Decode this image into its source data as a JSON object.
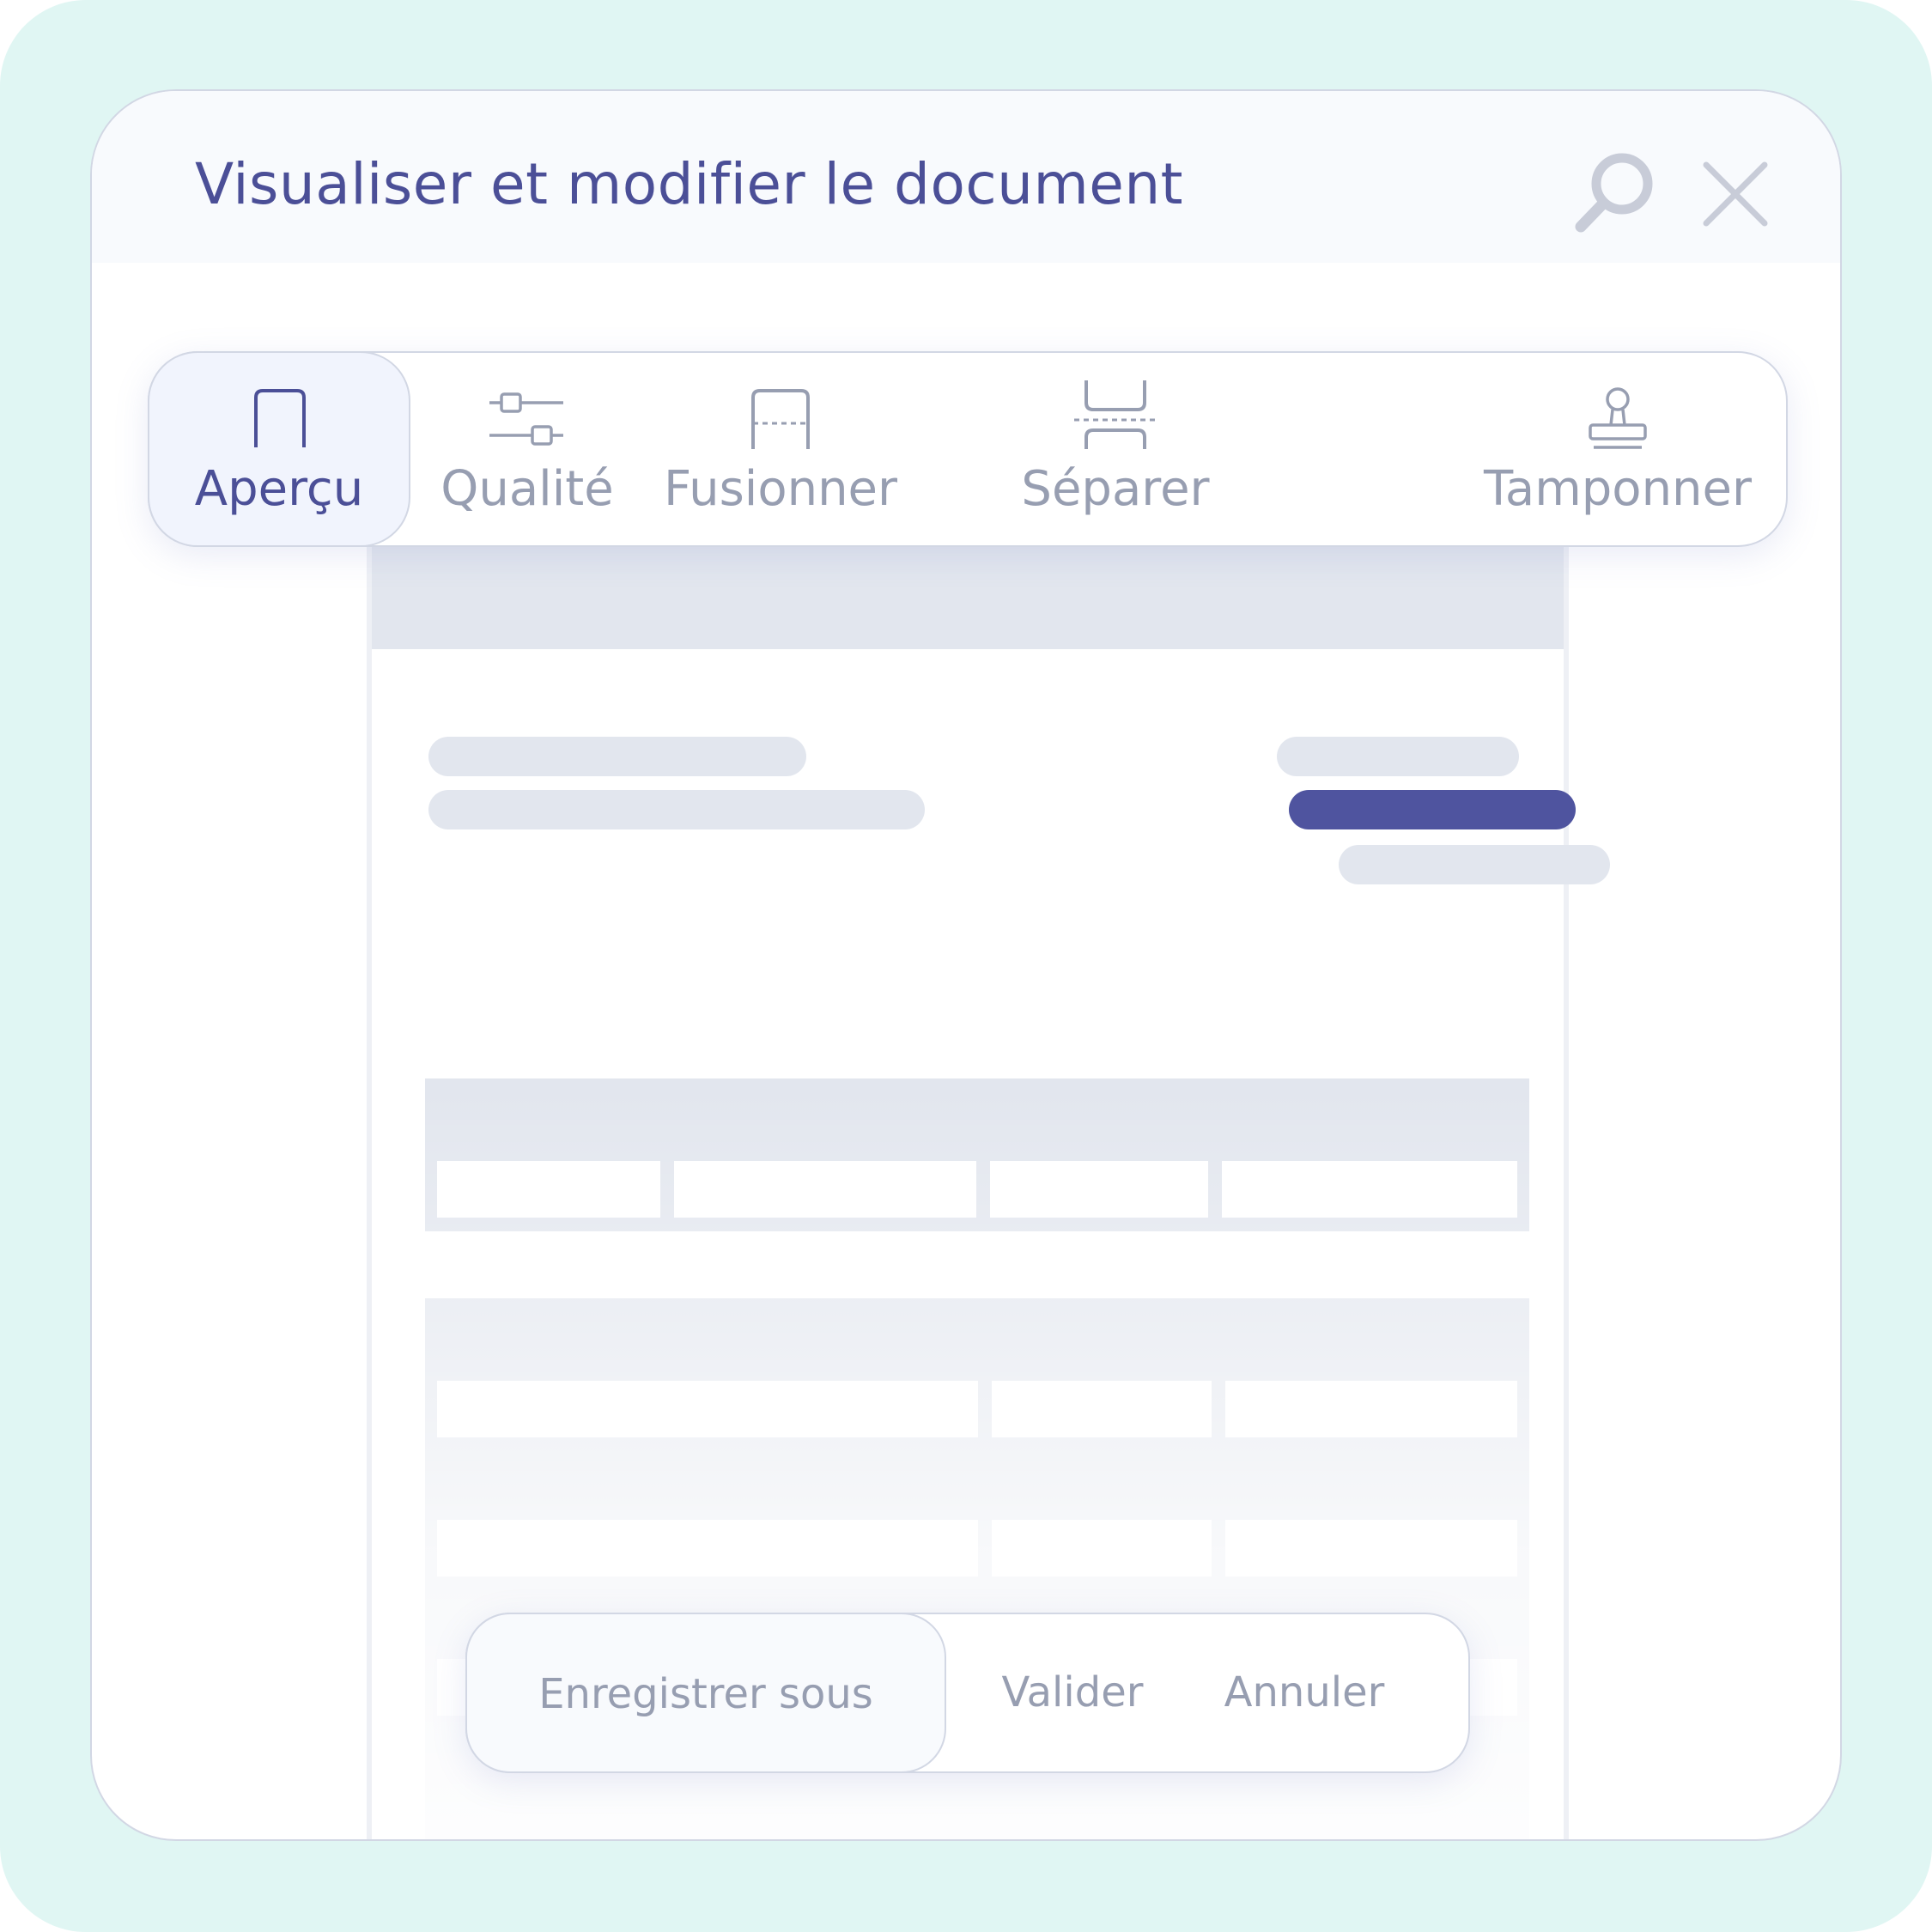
{
  "window": {
    "title": "Visualiser et modifier le document"
  },
  "toolbar": {
    "tabs": [
      {
        "label": "Aperçu",
        "icon": "preview-icon",
        "active": true
      },
      {
        "label": "Qualité",
        "icon": "sliders-icon",
        "active": false
      },
      {
        "label": "Fusionner",
        "icon": "merge-icon",
        "active": false
      },
      {
        "label": "Séparer",
        "icon": "split-icon",
        "active": false
      },
      {
        "label": "Tamponner",
        "icon": "stamp-icon",
        "active": false
      }
    ]
  },
  "actions": {
    "save_as": "Enregistrer sous",
    "validate": "Valider",
    "cancel": "Annuler"
  },
  "colors": {
    "background": "#e0f6f3",
    "accent": "#4b4f97",
    "muted": "#979eb1",
    "placeholder": "#e2e6ee"
  }
}
